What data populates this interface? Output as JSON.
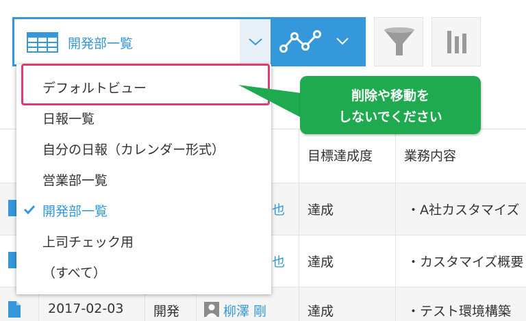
{
  "toolbar": {
    "current_view": "開発部一覧"
  },
  "table": {
    "headers": {
      "target_achievement": "目標達成度",
      "task_content": "業務内容"
    },
    "rows": [
      {
        "user_suffix": "也",
        "achievement": "達成",
        "task": "・A社カスタマイズ"
      },
      {
        "user_suffix": "也",
        "achievement": "達成",
        "task": "・カスタマイズ概要"
      },
      {
        "date": "2017-02-03",
        "department": "開発",
        "user": "柳澤 剛",
        "achievement": "達成",
        "task": "・テスト環境構築"
      }
    ]
  },
  "view_menu": {
    "items": [
      {
        "label": "デフォルトビュー"
      },
      {
        "label": "日報一覧"
      },
      {
        "label": "自分の日報（カレンダー形式）"
      },
      {
        "label": "営業部一覧"
      },
      {
        "label": "開発部一覧"
      },
      {
        "label": "上司チェック用"
      },
      {
        "label": "（すべて）"
      }
    ],
    "selected_label": "開発部一覧"
  },
  "callout": {
    "line1": "削除や移動を",
    "line2": "しないでください"
  },
  "icons": {
    "view_table": "table-icon",
    "view_dropdown": "chevron-down-icon",
    "graph": "line-graph-icon",
    "filter": "funnel-icon",
    "chart": "bar-chart-icon",
    "record": "document-icon",
    "user": "user-icon",
    "selected": "checkmark-icon"
  },
  "colors": {
    "accent": "#3498db",
    "highlight_border": "#e8386a",
    "callout_bg": "#1faa4f"
  }
}
